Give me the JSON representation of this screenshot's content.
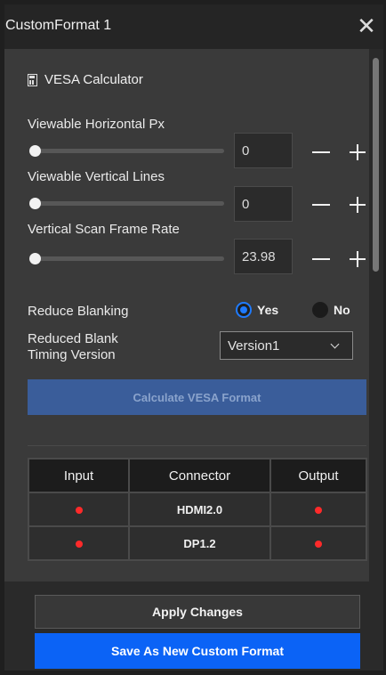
{
  "window": {
    "title": "CustomFormat 1",
    "close_icon": "close-icon"
  },
  "section": {
    "title": "VESA Calculator",
    "icon": "calculator-icon"
  },
  "fields": [
    {
      "label": "Viewable Horizontal Px",
      "value": "0"
    },
    {
      "label": "Viewable Vertical Lines",
      "value": "0"
    },
    {
      "label": "Vertical Scan Frame Rate",
      "value": "23.98"
    }
  ],
  "reduce_blanking": {
    "label": "Reduce Blanking",
    "yes": "Yes",
    "no": "No",
    "selected": "Yes"
  },
  "timing": {
    "label_line1": "Reduced Blank",
    "label_line2": "Timing Version",
    "value": "Version1"
  },
  "calculate_button": "Calculate VESA Format",
  "table": {
    "headers": [
      "Input",
      "Connector",
      "Output"
    ],
    "rows": [
      {
        "connector": "HDMI2.0"
      },
      {
        "connector": "DP1.2"
      }
    ],
    "status_color": "#ff2a2a"
  },
  "footer": {
    "apply_label": "Apply Changes",
    "save_label": "Save As New Custom Format"
  },
  "colors": {
    "accent": "#0b63f6",
    "radio_selected": "#1f7bff",
    "disabled_button": "#3a5d9a"
  }
}
